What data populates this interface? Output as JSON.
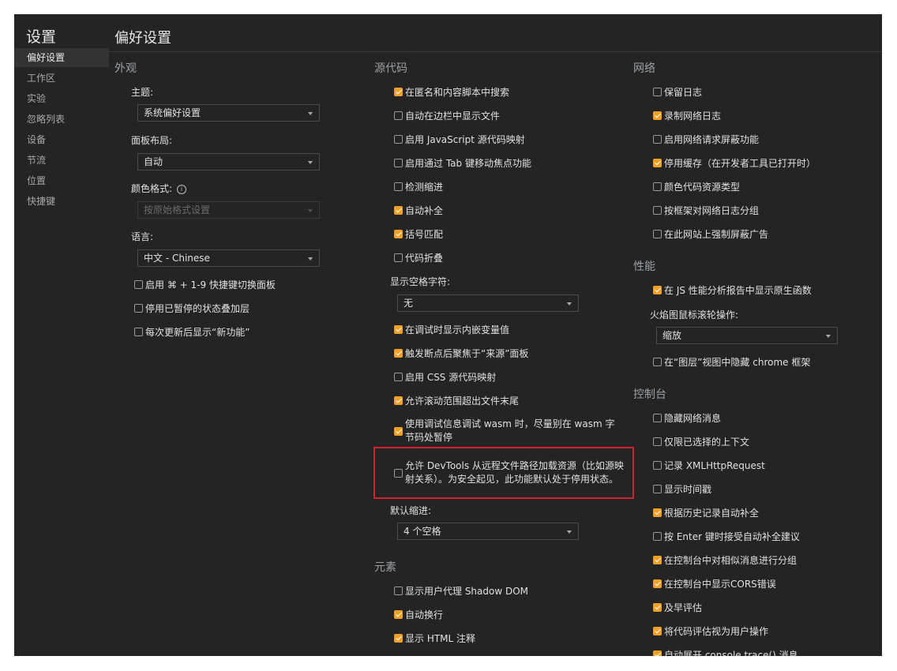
{
  "sidebar": {
    "title": "设置",
    "items": [
      {
        "label": "偏好设置",
        "active": true
      },
      {
        "label": "工作区"
      },
      {
        "label": "实验"
      },
      {
        "label": "忽略列表"
      },
      {
        "label": "设备"
      },
      {
        "label": "节流"
      },
      {
        "label": "位置"
      },
      {
        "label": "快捷键"
      }
    ]
  },
  "main": {
    "title": "偏好设置"
  },
  "appearance": {
    "section": "外观",
    "theme_label": "主题:",
    "theme_value": "系统偏好设置",
    "panel_label": "面板布局:",
    "panel_value": "自动",
    "color_label": "颜色格式:",
    "color_value": "按原始格式设置",
    "lang_label": "语言:",
    "lang_value": "中文 - Chinese",
    "checkboxes": [
      {
        "label": "启用 ⌘ + 1-9 快捷键切换面板",
        "checked": false
      },
      {
        "label": "停用已暂停的状态叠加层",
        "checked": false
      },
      {
        "label": "每次更新后显示“新功能”",
        "checked": false
      }
    ]
  },
  "sources": {
    "section": "源代码",
    "checkboxes1": [
      {
        "label": "在匿名和内容脚本中搜索",
        "checked": true
      },
      {
        "label": "自动在边栏中显示文件",
        "checked": false
      },
      {
        "label": "启用 JavaScript 源代码映射",
        "checked": false
      },
      {
        "label": "启用通过 Tab 键移动焦点功能",
        "checked": false
      },
      {
        "label": "检测缩进",
        "checked": false
      },
      {
        "label": "自动补全",
        "checked": true
      },
      {
        "label": "括号匹配",
        "checked": true
      },
      {
        "label": "代码折叠",
        "checked": false
      }
    ],
    "whitespace_label": "显示空格字符:",
    "whitespace_value": "无",
    "checkboxes2": [
      {
        "label": "在调试时显示内嵌变量值",
        "checked": true
      },
      {
        "label": "触发断点后聚焦于“来源”面板",
        "checked": true
      },
      {
        "label": "启用 CSS 源代码映射",
        "checked": false
      },
      {
        "label": "允许滚动范围超出文件末尾",
        "checked": true
      }
    ],
    "wasm_label": "使用调试信息调试 wasm 时，尽量别在 wasm 字节码处暂停",
    "wasm_checked": true,
    "remote_label": "允许 DevTools 从远程文件路径加载资源（比如源映射关系）。为安全起见，此功能默认处于停用状态。",
    "remote_checked": false,
    "indent_label": "默认缩进:",
    "indent_value": "4 个空格"
  },
  "elements": {
    "section": "元素",
    "checkboxes": [
      {
        "label": "显示用户代理 Shadow DOM",
        "checked": false
      },
      {
        "label": "自动换行",
        "checked": true
      },
      {
        "label": "显示 HTML 注释",
        "checked": true
      }
    ]
  },
  "network": {
    "section": "网络",
    "checkboxes": [
      {
        "label": "保留日志",
        "checked": false
      },
      {
        "label": "录制网络日志",
        "checked": true
      },
      {
        "label": "启用网络请求屏蔽功能",
        "checked": false
      },
      {
        "label": "停用缓存（在开发者工具已打开时）",
        "checked": true
      },
      {
        "label": "颜色代码资源类型",
        "checked": false
      },
      {
        "label": "按框架对网络日志分组",
        "checked": false
      },
      {
        "label": "在此网站上强制屏蔽广告",
        "checked": false
      }
    ]
  },
  "performance": {
    "section": "性能",
    "native_label": "在 JS 性能分析报告中显示原生函数",
    "native_checked": true,
    "flame_label": "火焰图鼠标滚轮操作:",
    "flame_value": "缩放",
    "layers_label": "在“图层”视图中隐藏 chrome 框架",
    "layers_checked": false
  },
  "console": {
    "section": "控制台",
    "checkboxes": [
      {
        "label": "隐藏网络消息",
        "checked": false
      },
      {
        "label": "仅限已选择的上下文",
        "checked": false
      },
      {
        "label": "记录 XMLHttpRequest",
        "checked": false
      },
      {
        "label": "显示时间戳",
        "checked": false
      },
      {
        "label": "根据历史记录自动补全",
        "checked": true
      },
      {
        "label": "按 Enter 键时接受自动补全建议",
        "checked": false
      },
      {
        "label": "在控制台中对相似消息进行分组",
        "checked": true
      },
      {
        "label": "在控制台中显示CORS错误",
        "checked": true
      },
      {
        "label": "及早评估",
        "checked": true
      },
      {
        "label": "将代码评估视为用户操作",
        "checked": true
      },
      {
        "label": "自动展开 console.trace() 消息",
        "checked": true
      }
    ]
  }
}
